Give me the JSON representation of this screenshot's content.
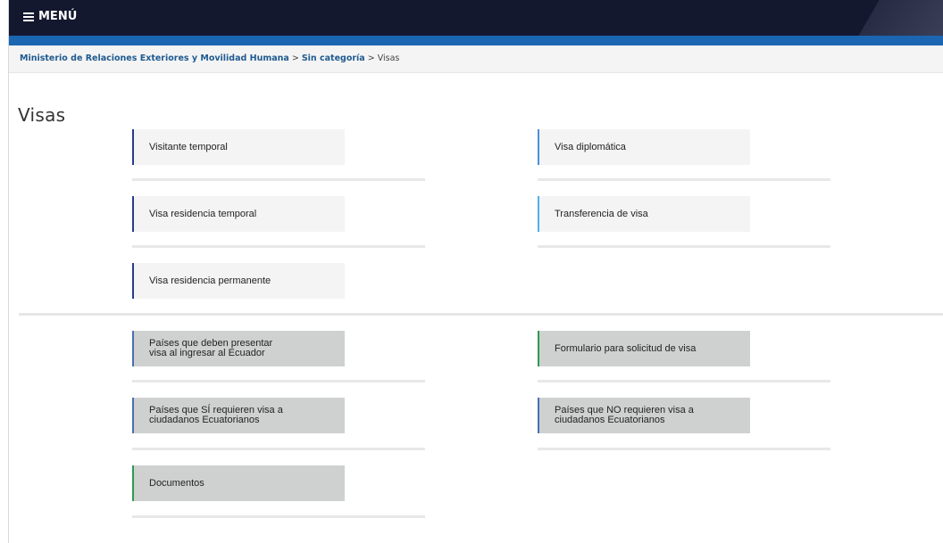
{
  "header": {
    "menu_label": "MENÚ"
  },
  "breadcrumb": {
    "item1": "Ministerio de Relaciones Exteriores y Movilidad Humana",
    "sep1": " > ",
    "item2": "Sin categoría",
    "sep2": " > ",
    "current": "Visas"
  },
  "page": {
    "title": "Visas"
  },
  "visa_cards": [
    {
      "label": "Visitante temporal",
      "accent": "#2a3a8c"
    },
    {
      "label": "Visa diplomática",
      "accent": "#4a90d9"
    },
    {
      "label": "Visa residencia temporal",
      "accent": "#2a3a8c"
    },
    {
      "label": "Transferencia de visa",
      "accent": "#4fb0e8"
    },
    {
      "label": "Visa residencia permanente",
      "accent": "#2a3a8c"
    }
  ],
  "info_cards": [
    {
      "line1": "Países que deben presentar",
      "line2": "visa al ingresar al Ecuador",
      "accent": "#4a6fb5"
    },
    {
      "line1": "Formulario para solicitud de visa",
      "line2": "",
      "accent": "#2f9a55"
    },
    {
      "line1": "Países que SÍ requieren visa a",
      "line2": "ciudadanos Ecuatorianos",
      "accent": "#4a6fb5"
    },
    {
      "line1": "Países que NO requieren visa a",
      "line2": "ciudadanos Ecuatorianos",
      "accent": "#4a6fb5"
    },
    {
      "line1": "Documentos",
      "line2": "",
      "accent": "#2f9a55"
    }
  ],
  "colors": {
    "topbar": "#14182f",
    "stripe": "#1b66b0",
    "breadcrumb_link": "#1f5a8f"
  }
}
